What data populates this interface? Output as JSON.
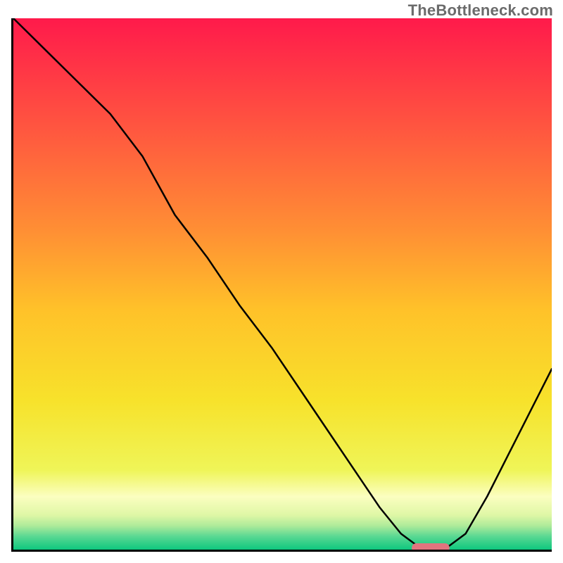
{
  "watermark": "TheBottleneck.com",
  "chart_data": {
    "type": "line",
    "title": "",
    "xlabel": "",
    "ylabel": "",
    "xlim": [
      0,
      100
    ],
    "ylim": [
      0,
      100
    ],
    "grid": false,
    "legend": false,
    "x": [
      0,
      6,
      12,
      18,
      24,
      30,
      36,
      42,
      48,
      54,
      60,
      64,
      68,
      72,
      76,
      80,
      84,
      88,
      92,
      96,
      100
    ],
    "values": [
      100,
      94,
      88,
      82,
      74,
      63,
      55,
      46,
      38,
      29,
      20,
      14,
      8,
      3,
      0,
      0,
      3,
      10,
      18,
      26,
      34
    ],
    "marker": {
      "x": 77.5,
      "width": 7,
      "color": "#e2747e"
    },
    "background": {
      "type": "vertical-gradient",
      "stops": [
        {
          "pos": 0.0,
          "color": "#ff1a4b"
        },
        {
          "pos": 0.2,
          "color": "#ff5440"
        },
        {
          "pos": 0.4,
          "color": "#ff8f34"
        },
        {
          "pos": 0.55,
          "color": "#ffc229"
        },
        {
          "pos": 0.72,
          "color": "#f7e22b"
        },
        {
          "pos": 0.85,
          "color": "#eff558"
        },
        {
          "pos": 0.9,
          "color": "#fbfec0"
        },
        {
          "pos": 0.935,
          "color": "#dff7a6"
        },
        {
          "pos": 0.955,
          "color": "#aeeb9a"
        },
        {
          "pos": 0.975,
          "color": "#5ad893"
        },
        {
          "pos": 1.0,
          "color": "#0ec77e"
        }
      ]
    }
  }
}
